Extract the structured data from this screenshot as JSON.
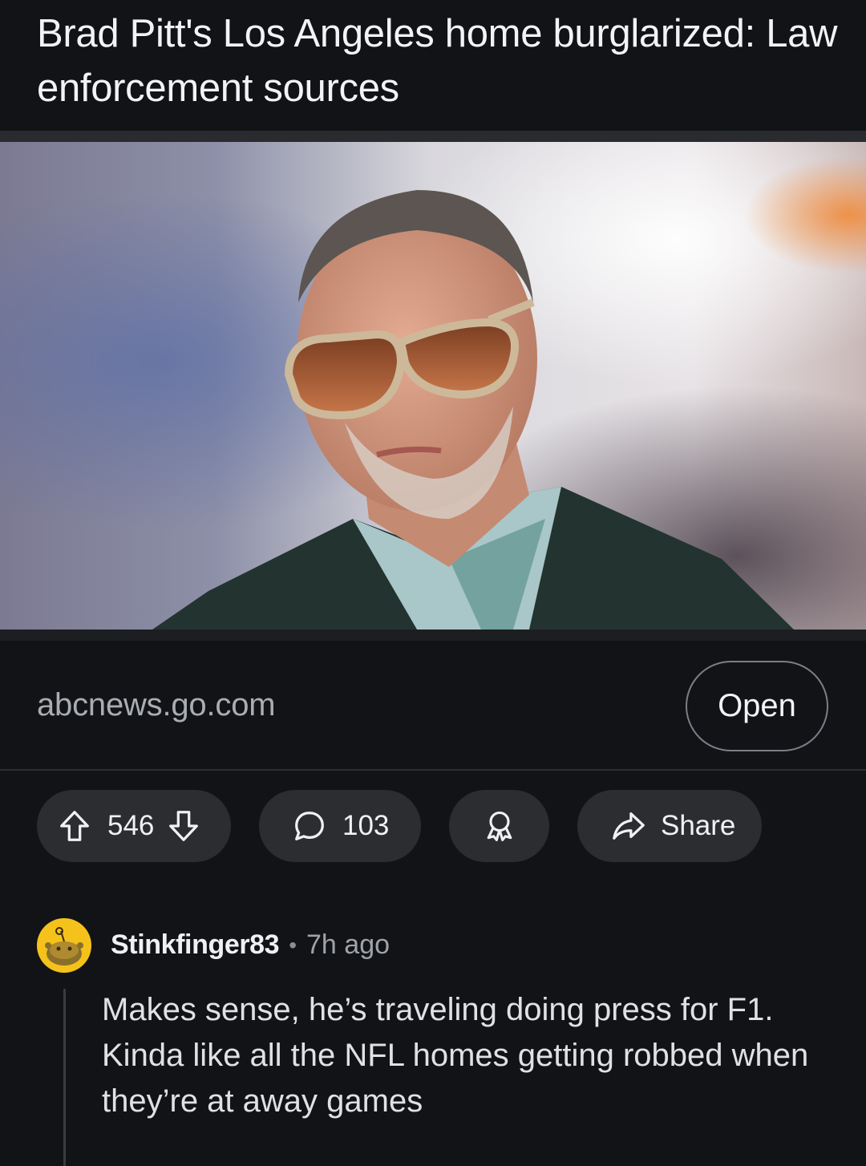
{
  "post": {
    "title": "Brad Pitt's Los Angeles home burglarized: Law enforcement sources",
    "domain": "abcnews.go.com",
    "open_label": "Open"
  },
  "actions": {
    "votes": "546",
    "comments": "103",
    "share_label": "Share"
  },
  "comment": {
    "username": "Stinkfinger83",
    "separator": "•",
    "time": "7h ago",
    "body": "Makes sense, he’s traveling doing press for F1. Kinda like all the NFL homes getting robbed when they’re at away games"
  },
  "icons": {
    "upvote": "upvote-arrow-icon",
    "downvote": "downvote-arrow-icon",
    "comment": "speech-bubble-icon",
    "award": "award-ribbon-icon",
    "share": "share-arrow-icon",
    "avatar": "snoo-avatar-icon"
  },
  "colors": {
    "background": "#121316",
    "pill": "#2b2d31",
    "avatar": "#f4c21b",
    "domain_text": "#a9adb2"
  }
}
